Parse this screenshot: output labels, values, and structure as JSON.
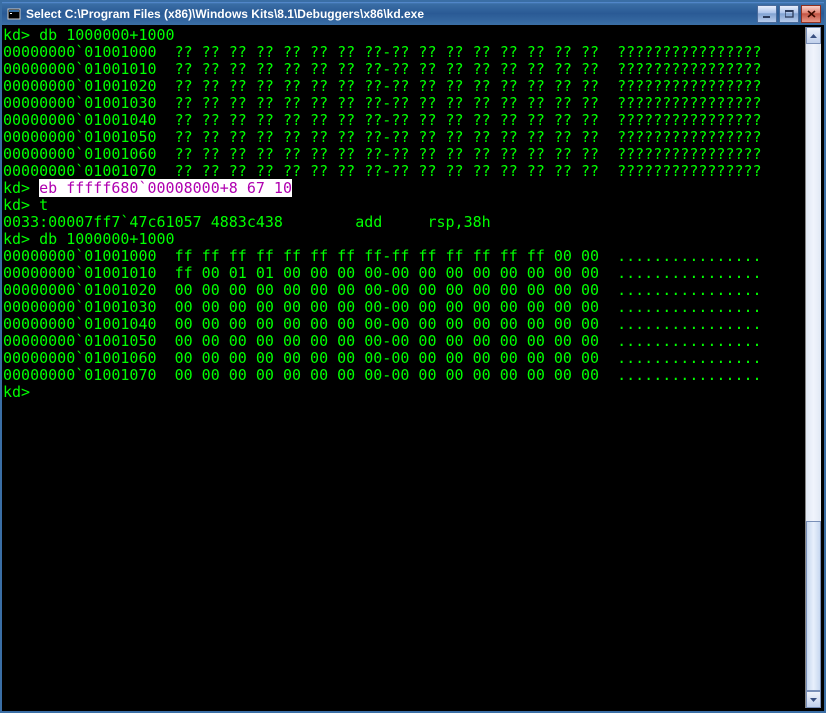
{
  "window": {
    "title": "Select C:\\Program Files (x86)\\Windows Kits\\8.1\\Debuggers\\x86\\kd.exe"
  },
  "terminal": {
    "prompt": "kd>",
    "commands": {
      "db1": "db 1000000+1000",
      "eb": "eb fffff680`00008000+8 67 10",
      "t": "t",
      "db2": "db 1000000+1000"
    },
    "dump1": {
      "addr_prefix": "00000000`",
      "rows": [
        {
          "addr": "01001000",
          "bytes": "?? ?? ?? ?? ?? ?? ?? ??-?? ?? ?? ?? ?? ?? ?? ??",
          "ascii": "????????????????"
        },
        {
          "addr": "01001010",
          "bytes": "?? ?? ?? ?? ?? ?? ?? ??-?? ?? ?? ?? ?? ?? ?? ??",
          "ascii": "????????????????"
        },
        {
          "addr": "01001020",
          "bytes": "?? ?? ?? ?? ?? ?? ?? ??-?? ?? ?? ?? ?? ?? ?? ??",
          "ascii": "????????????????"
        },
        {
          "addr": "01001030",
          "bytes": "?? ?? ?? ?? ?? ?? ?? ??-?? ?? ?? ?? ?? ?? ?? ??",
          "ascii": "????????????????"
        },
        {
          "addr": "01001040",
          "bytes": "?? ?? ?? ?? ?? ?? ?? ??-?? ?? ?? ?? ?? ?? ?? ??",
          "ascii": "????????????????"
        },
        {
          "addr": "01001050",
          "bytes": "?? ?? ?? ?? ?? ?? ?? ??-?? ?? ?? ?? ?? ?? ?? ??",
          "ascii": "????????????????"
        },
        {
          "addr": "01001060",
          "bytes": "?? ?? ?? ?? ?? ?? ?? ??-?? ?? ?? ?? ?? ?? ?? ??",
          "ascii": "????????????????"
        },
        {
          "addr": "01001070",
          "bytes": "?? ?? ?? ?? ?? ?? ?? ??-?? ?? ?? ?? ?? ?? ?? ??",
          "ascii": "????????????????"
        }
      ]
    },
    "trace_line": "0033:00007ff7`47c61057 4883c438        add     rsp,38h",
    "dump2": {
      "addr_prefix": "00000000`",
      "rows": [
        {
          "addr": "01001000",
          "bytes": "ff ff ff ff ff ff ff ff-ff ff ff ff ff ff 00 00",
          "ascii": "................"
        },
        {
          "addr": "01001010",
          "bytes": "ff 00 01 01 00 00 00 00-00 00 00 00 00 00 00 00",
          "ascii": "................"
        },
        {
          "addr": "01001020",
          "bytes": "00 00 00 00 00 00 00 00-00 00 00 00 00 00 00 00",
          "ascii": "................"
        },
        {
          "addr": "01001030",
          "bytes": "00 00 00 00 00 00 00 00-00 00 00 00 00 00 00 00",
          "ascii": "................"
        },
        {
          "addr": "01001040",
          "bytes": "00 00 00 00 00 00 00 00-00 00 00 00 00 00 00 00",
          "ascii": "................"
        },
        {
          "addr": "01001050",
          "bytes": "00 00 00 00 00 00 00 00-00 00 00 00 00 00 00 00",
          "ascii": "................"
        },
        {
          "addr": "01001060",
          "bytes": "00 00 00 00 00 00 00 00-00 00 00 00 00 00 00 00",
          "ascii": "................"
        },
        {
          "addr": "01001070",
          "bytes": "00 00 00 00 00 00 00 00-00 00 00 00 00 00 00 00",
          "ascii": "................"
        }
      ]
    }
  }
}
